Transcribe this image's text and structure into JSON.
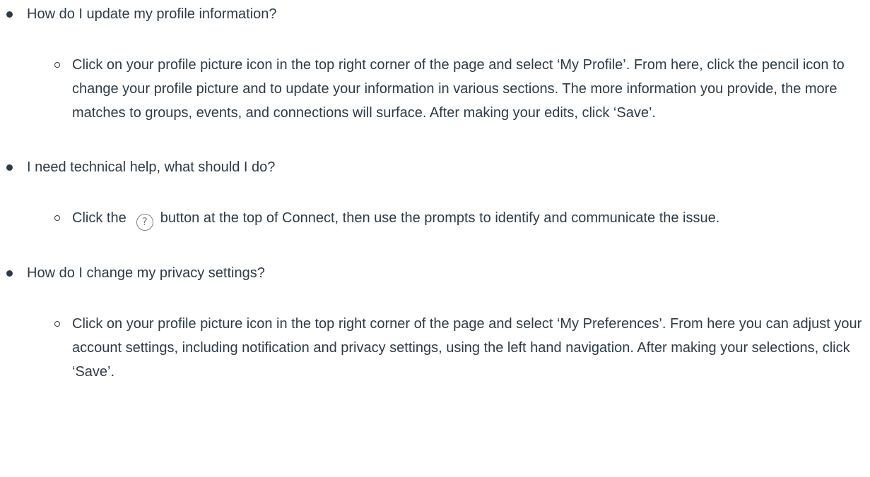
{
  "faq": {
    "items": [
      {
        "question": "How do I update my profile information?",
        "answer": "Click on your profile picture icon in the top right corner of the page and select ‘My Profile’. From here, click the pencil icon to change your profile picture and to update your information in various sections. The more information you provide, the more matches to groups, events, and connections will surface. After making your edits, click ‘Save’."
      },
      {
        "question": "I need technical help, what should I do?",
        "answer_before_icon": "Click the",
        "answer_icon": "help-question-icon",
        "answer_after_icon": "button at the top of Connect, then use the prompts to identify and communicate the issue."
      },
      {
        "question": "How do I change my privacy settings?",
        "answer": "Click on your profile picture icon in the top right corner of the page and select ‘My Preferences’. From here you can adjust your account settings, including notification and privacy settings, using the left hand navigation. After making your selections, click ‘Save’."
      }
    ],
    "help_icon_glyph": "?"
  }
}
